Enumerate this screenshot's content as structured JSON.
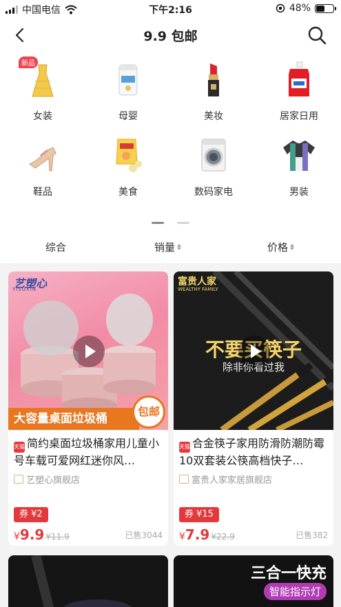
{
  "status": {
    "carrier": "中国电信",
    "time": "下午2:16",
    "battery": "48%",
    "battery_level": 0.48
  },
  "nav": {
    "title": "9.9 包邮"
  },
  "categories": [
    {
      "label": "女装",
      "icon": "dress-icon",
      "tag": "新品"
    },
    {
      "label": "母婴",
      "icon": "milk-powder-icon"
    },
    {
      "label": "美妆",
      "icon": "lipstick-icon"
    },
    {
      "label": "居家日用",
      "icon": "detergent-icon"
    },
    {
      "label": "鞋品",
      "icon": "heel-shoe-icon"
    },
    {
      "label": "美食",
      "icon": "snack-icon"
    },
    {
      "label": "数码家电",
      "icon": "washing-machine-icon"
    },
    {
      "label": "男装",
      "icon": "tshirt-icon"
    }
  ],
  "sort": {
    "tabs": [
      "综合",
      "销量",
      "价格"
    ]
  },
  "products": [
    {
      "image_brand": "艺塑心",
      "image_brand_en": "YISUXIN",
      "image_banner": "大容量桌面垃圾桶",
      "image_badge": "包邮",
      "title": "简约桌面垃圾桶家用儿童小号车载可爱网红迷你风…",
      "shop": "艺塑心旗舰店",
      "coupon": "券 ¥2",
      "price_symbol": "¥",
      "price": "9.9",
      "original_price": "¥11.9",
      "sold": "已售3044"
    },
    {
      "image_brand": "富贵人家",
      "image_brand_en": "WEALTHY FAMILY",
      "image_headline": "不要买筷子",
      "image_subline": "除非你看过我",
      "title": "合金筷子家用防滑防潮防霉10双套装公筷高档快子…",
      "shop": "富贵人家家居旗舰店",
      "coupon": "券 ¥15",
      "price_symbol": "¥",
      "price": "7.9",
      "original_price": "¥22.9",
      "sold": "已售382"
    }
  ],
  "next_products": [
    {
      "image_text": ""
    },
    {
      "image_text": "三合一快充",
      "image_badge": "智能指示灯"
    }
  ],
  "colors": {
    "accent": "#e4393c",
    "page_bg": "#f3f3f3"
  }
}
